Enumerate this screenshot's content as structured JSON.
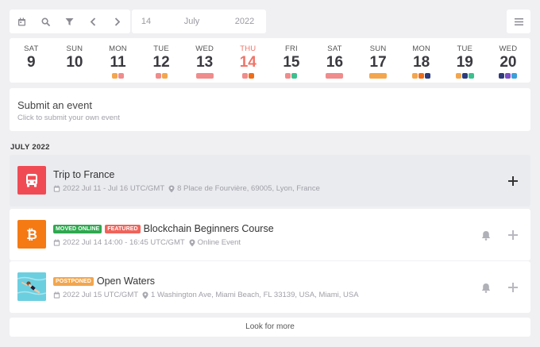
{
  "toolbar": {
    "icons": [
      "calendar-icon",
      "search-icon",
      "filter-icon",
      "chevron-left-icon",
      "chevron-right-icon"
    ],
    "date": {
      "day": "14",
      "month": "July",
      "year": "2022"
    },
    "menu_icon": "hamburger-menu-icon"
  },
  "week": [
    {
      "dow": "SAT",
      "num": "9",
      "today": false,
      "dots": []
    },
    {
      "dow": "SUN",
      "num": "10",
      "today": false,
      "dots": []
    },
    {
      "dow": "MON",
      "num": "11",
      "today": false,
      "dots": [
        "#f3a64d",
        "#f08c8c"
      ]
    },
    {
      "dow": "TUE",
      "num": "12",
      "today": false,
      "dots": [
        "#f08c8c",
        "#f3a64d"
      ]
    },
    {
      "dow": "WED",
      "num": "13",
      "today": false,
      "dots": [
        "#f08c8c"
      ]
    },
    {
      "dow": "THU",
      "num": "14",
      "today": true,
      "dots": [
        "#f08c8c",
        "#ef6c18"
      ]
    },
    {
      "dow": "FRI",
      "num": "15",
      "today": false,
      "dots": [
        "#f08c8c",
        "#3cc08e"
      ]
    },
    {
      "dow": "SAT",
      "num": "16",
      "today": false,
      "dots": [
        "#f08c8c"
      ]
    },
    {
      "dow": "SUN",
      "num": "17",
      "today": false,
      "dots": [
        "#f3a64d"
      ]
    },
    {
      "dow": "MON",
      "num": "18",
      "today": false,
      "dots": [
        "#f3a64d",
        "#ef6c18",
        "#2e3a7a"
      ]
    },
    {
      "dow": "TUE",
      "num": "19",
      "today": false,
      "dots": [
        "#f3a64d",
        "#2e3a7a",
        "#3cc08e"
      ]
    },
    {
      "dow": "WED",
      "num": "20",
      "today": false,
      "dots": [
        "#2e3a7a",
        "#7a4fc7",
        "#3aa0d8"
      ]
    }
  ],
  "submit": {
    "title": "Submit an event",
    "subtitle": "Click to submit your own event"
  },
  "section_label": "JULY 2022",
  "events": [
    {
      "title": "Trip to France",
      "date": "2022 Jul 11 - Jul 16 UTC/GMT",
      "location": "8 Place de Fourvière, 69005, Lyon, France",
      "badges": [],
      "thumb_icon": "bus-icon",
      "thumb_color": "#f04b55",
      "has_bell": false
    },
    {
      "title": "Blockchain Beginners Course",
      "date": "2022 Jul 14 14:00 - 16:45 UTC/GMT",
      "location": "Online Event",
      "badges": [
        {
          "label": "MOVED ONLINE",
          "color": "#2ea94f"
        },
        {
          "label": "FEATURED",
          "color": "#f0645a"
        }
      ],
      "thumb_icon": "bitcoin-icon",
      "thumb_color": "#f57a14",
      "has_bell": true
    },
    {
      "title": "Open Waters",
      "date": "2022 Jul 15 UTC/GMT",
      "location": "1 Washington Ave, Miami Beach, FL 33139, USA, Miami, USA",
      "badges": [
        {
          "label": "POSTPONED",
          "color": "#f3a64d"
        }
      ],
      "thumb_icon": "swimmer-photo",
      "thumb_color": "#5fc6d8",
      "has_bell": true
    }
  ],
  "more_label": "Look for more"
}
